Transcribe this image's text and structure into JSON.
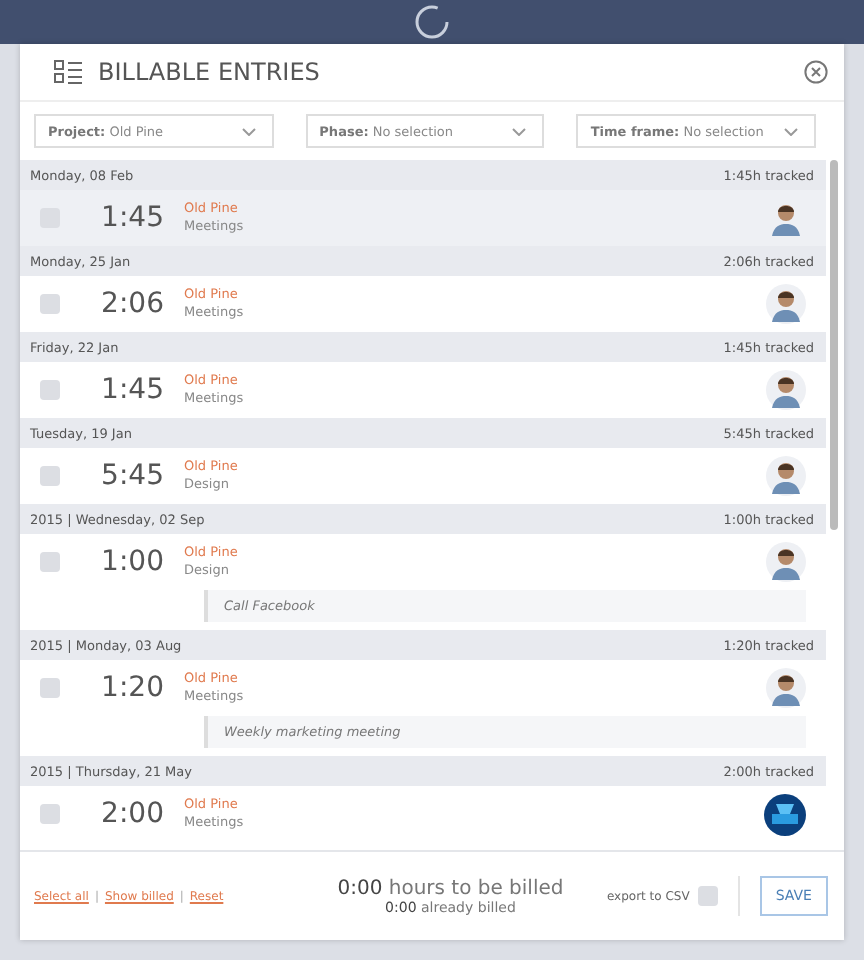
{
  "dialog": {
    "title": "BILLABLE ENTRIES"
  },
  "filters": [
    {
      "label": "Project:",
      "value": "Old Pine"
    },
    {
      "label": "Phase:",
      "value": "No selection"
    },
    {
      "label": "Time frame:",
      "value": "No selection"
    }
  ],
  "groups": [
    {
      "date": "Monday, 08 Feb",
      "tracked": "1:45h tracked",
      "entries": [
        {
          "checked": false,
          "duration": "1:45",
          "project": "Old Pine",
          "phase": "Meetings",
          "kind": "photo",
          "hovered": true
        }
      ]
    },
    {
      "date": "Monday, 25 Jan",
      "tracked": "2:06h tracked",
      "entries": [
        {
          "checked": false,
          "duration": "2:06",
          "project": "Old Pine",
          "phase": "Meetings",
          "kind": "photo",
          "hovered": false
        }
      ]
    },
    {
      "date": "Friday, 22 Jan",
      "tracked": "1:45h tracked",
      "entries": [
        {
          "checked": false,
          "duration": "1:45",
          "project": "Old Pine",
          "phase": "Meetings",
          "kind": "photo",
          "hovered": false
        }
      ]
    },
    {
      "date": "Tuesday, 19 Jan",
      "tracked": "5:45h tracked",
      "entries": [
        {
          "checked": false,
          "duration": "5:45",
          "project": "Old Pine",
          "phase": "Design",
          "kind": "photo",
          "hovered": false
        }
      ]
    },
    {
      "date": "2015 | Wednesday, 02 Sep",
      "tracked": "1:00h tracked",
      "entries": [
        {
          "checked": false,
          "duration": "1:00",
          "project": "Old Pine",
          "phase": "Design",
          "kind": "photo",
          "hovered": false,
          "note": "Call Facebook"
        }
      ]
    },
    {
      "date": "2015 | Monday, 03 Aug",
      "tracked": "1:20h tracked",
      "entries": [
        {
          "checked": false,
          "duration": "1:20",
          "project": "Old Pine",
          "phase": "Meetings",
          "kind": "photo",
          "hovered": false,
          "note": "Weekly marketing meeting"
        }
      ]
    },
    {
      "date": "2015 | Thursday, 21 May",
      "tracked": "2:00h tracked",
      "entries": [
        {
          "checked": false,
          "duration": "2:00",
          "project": "Old Pine",
          "phase": "Meetings",
          "kind": "logo",
          "hovered": false
        }
      ]
    }
  ],
  "footer": {
    "links": [
      "Select all",
      "Show billed",
      "Reset"
    ],
    "separator": "|",
    "to_bill": {
      "value": "0:00",
      "label": "hours to be billed"
    },
    "billed": {
      "value": "0:00",
      "label": "already billed"
    },
    "export": {
      "label": "export to CSV",
      "checked": false
    },
    "save": "SAVE"
  }
}
